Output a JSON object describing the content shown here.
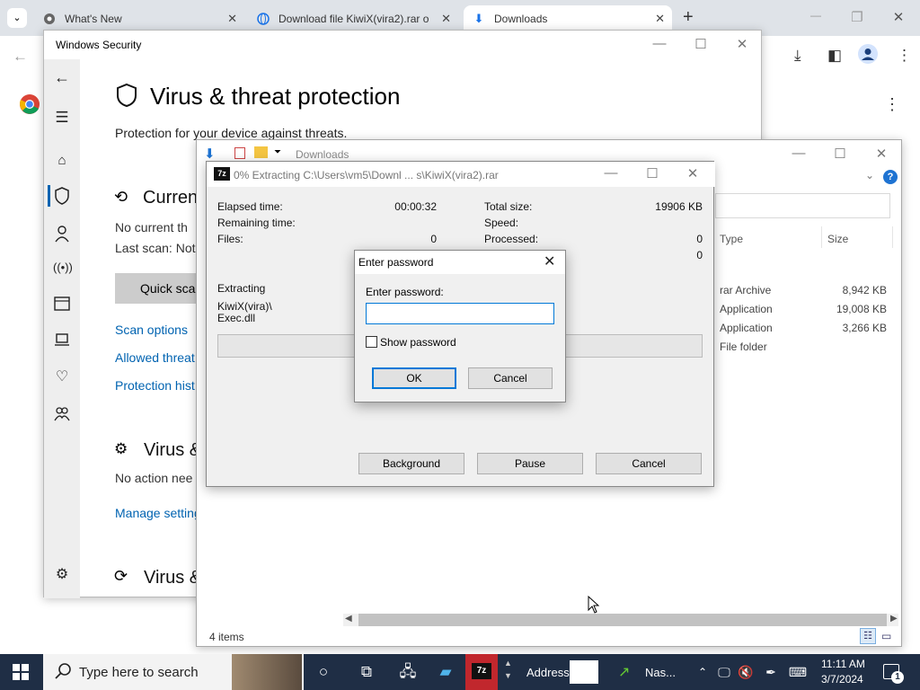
{
  "browser": {
    "tabs": [
      {
        "label": "What's New",
        "close": "✕"
      },
      {
        "label": "Download file KiwiX(vira2).rar o",
        "close": "✕"
      },
      {
        "label": "Downloads",
        "close": "✕"
      }
    ],
    "new_tab": "+",
    "window_controls": {
      "minimize": "—",
      "restore": "❐",
      "close": "✕"
    }
  },
  "windows_security": {
    "title": "Windows Security",
    "heading": "Virus & threat protection",
    "subtitle": "Protection for your device against threats.",
    "current_threats_heading": "Curren",
    "no_current": "No current th",
    "last_scan": "Last scan: Not",
    "quick_scan": "Quick scar",
    "links": [
      "Scan options",
      "Allowed threat",
      "Protection hist"
    ],
    "settings_heading": "Virus &",
    "no_action": "No action nee",
    "manage_settings": "Manage setting",
    "updates_heading": "Virus &"
  },
  "explorer": {
    "title": "Downloads",
    "columns": [
      "Type",
      "Size"
    ],
    "files": [
      {
        "type": "rar Archive",
        "size": "8,942 KB"
      },
      {
        "type": "Application",
        "size": "19,008 KB"
      },
      {
        "type": "Application",
        "size": "3,266 KB"
      },
      {
        "type": "File folder",
        "size": ""
      }
    ],
    "status": "4 items"
  },
  "zip_dialog": {
    "logo": "7z",
    "title": "0% Extracting C:\\Users\\vm5\\Downl ... s\\KiwiX(vira2).rar",
    "elapsed_label": "Elapsed time:",
    "elapsed_value": "00:00:32",
    "remaining_label": "Remaining time:",
    "files_label": "Files:",
    "files_value": "0",
    "total_label": "Total size:",
    "total_value": "19906 KB",
    "speed_label": "Speed:",
    "processed_label": "Processed:",
    "processed_value": "0",
    "extra_value": "0",
    "extracting_label": "Extracting",
    "current_path": "KiwiX(vira)\\",
    "current_file": "Exec.dll",
    "progress_percent": 0,
    "buttons": {
      "background": "Background",
      "pause": "Pause",
      "cancel": "Cancel"
    }
  },
  "password_dialog": {
    "title": "Enter password",
    "close": "✕",
    "label": "Enter password:",
    "value": "",
    "show_password": "Show password",
    "show_checked": false,
    "ok": "OK",
    "cancel": "Cancel"
  },
  "taskbar": {
    "search_placeholder": "Type here to search",
    "address_label": "Address",
    "nas_label": "Nas...",
    "time": "11:11 AM",
    "date": "3/7/2024",
    "notification_count": "1"
  }
}
